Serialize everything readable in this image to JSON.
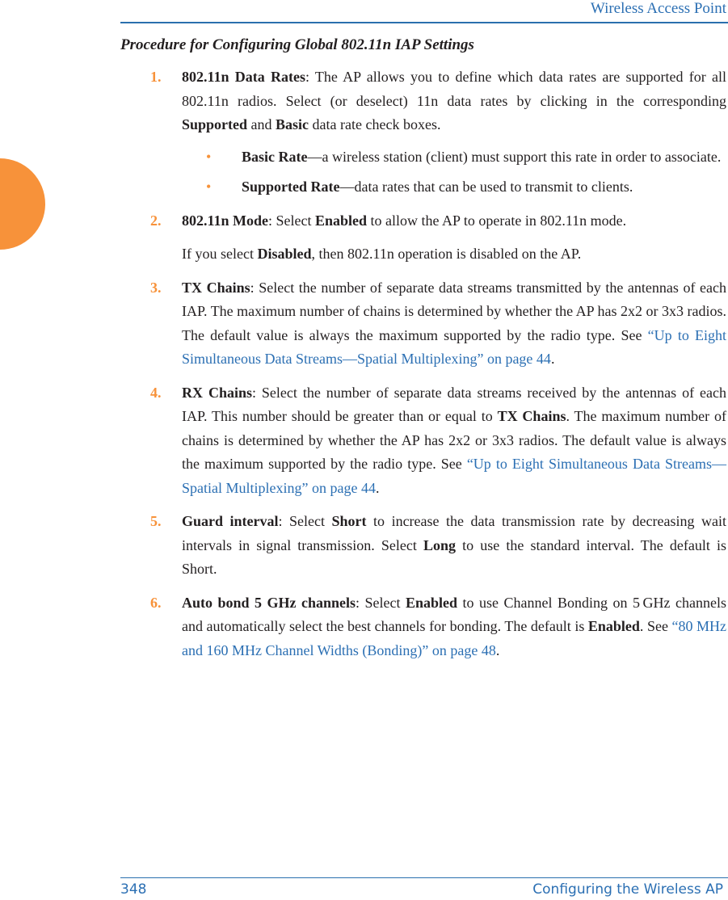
{
  "header": {
    "title": "Wireless Access Point"
  },
  "section_title": "Procedure for Configuring Global 802.11n IAP Settings",
  "steps": [
    {
      "num": "1.",
      "term": "802.11n Data Rates",
      "text_a": ": The AP allows you to define which data rates are supported for all 802.11n radios. Select (or deselect) 11n data rates by clicking in the corresponding ",
      "bold_a": "Supported",
      "text_b": " and ",
      "bold_b": "Basic",
      "text_c": " data rate check boxes.",
      "bullets": [
        {
          "term": "Basic Rate",
          "text": "—a wireless station (client) must support this rate in order to associate."
        },
        {
          "term": "Supported Rate",
          "text": "—data rates that can be used to transmit to clients."
        }
      ]
    },
    {
      "num": "2.",
      "term": "802.11n Mode",
      "text_a": ": Select ",
      "bold_a": "Enabled",
      "text_b": " to allow the AP to operate in 802.11n mode.",
      "para2_a": "If you select ",
      "para2_bold": "Disabled",
      "para2_b": ", then 802.11n operation is disabled on the AP."
    },
    {
      "num": "3.",
      "term": "TX Chains",
      "text_a": ": Select the number of separate data streams transmitted by the antennas of each IAP. The maximum number of chains is determined by whether the AP has 2x2 or 3x3 radios. The default value is always the maximum supported by the radio type. See ",
      "link": "“Up to Eight Simultaneous Data Streams—Spatial Multiplexing” on page 44",
      "text_b": "."
    },
    {
      "num": "4.",
      "term": "RX Chains",
      "text_a": ": Select the number of separate data streams received by the antennas of each IAP. This number should be greater than or equal to ",
      "bold_a": "TX Chains",
      "text_b": ". The maximum number of chains is determined by whether the AP has 2x2 or 3x3 radios. The default value is always the maximum supported by the radio type. See ",
      "link": "“Up to Eight Simultaneous Data Streams—Spatial Multiplexing” on page 44",
      "text_c": "."
    },
    {
      "num": "5.",
      "term": "Guard interval",
      "text_a": ": Select ",
      "bold_a": "Short",
      "text_b": " to increase the data transmission rate by decreasing wait intervals in signal transmission. Select ",
      "bold_b": "Long",
      "text_c": " to use the standard interval. The default is Short."
    },
    {
      "num": "6.",
      "term": "Auto bond 5 GHz channels",
      "text_a": ": Select ",
      "bold_a": "Enabled",
      "text_b": " to use Channel Bonding on 5 GHz channels and automatically select the best channels for bonding. The default is ",
      "bold_b": "Enabled",
      "text_c": ". See ",
      "link": "“80 MHz and 160 MHz Channel Widths (Bonding)” on page 48",
      "text_d": "."
    }
  ],
  "footer": {
    "page_number": "348",
    "chapter": "Configuring the Wireless AP"
  },
  "colors": {
    "accent_orange": "#f7923a",
    "link_blue": "#2b6fb3"
  }
}
